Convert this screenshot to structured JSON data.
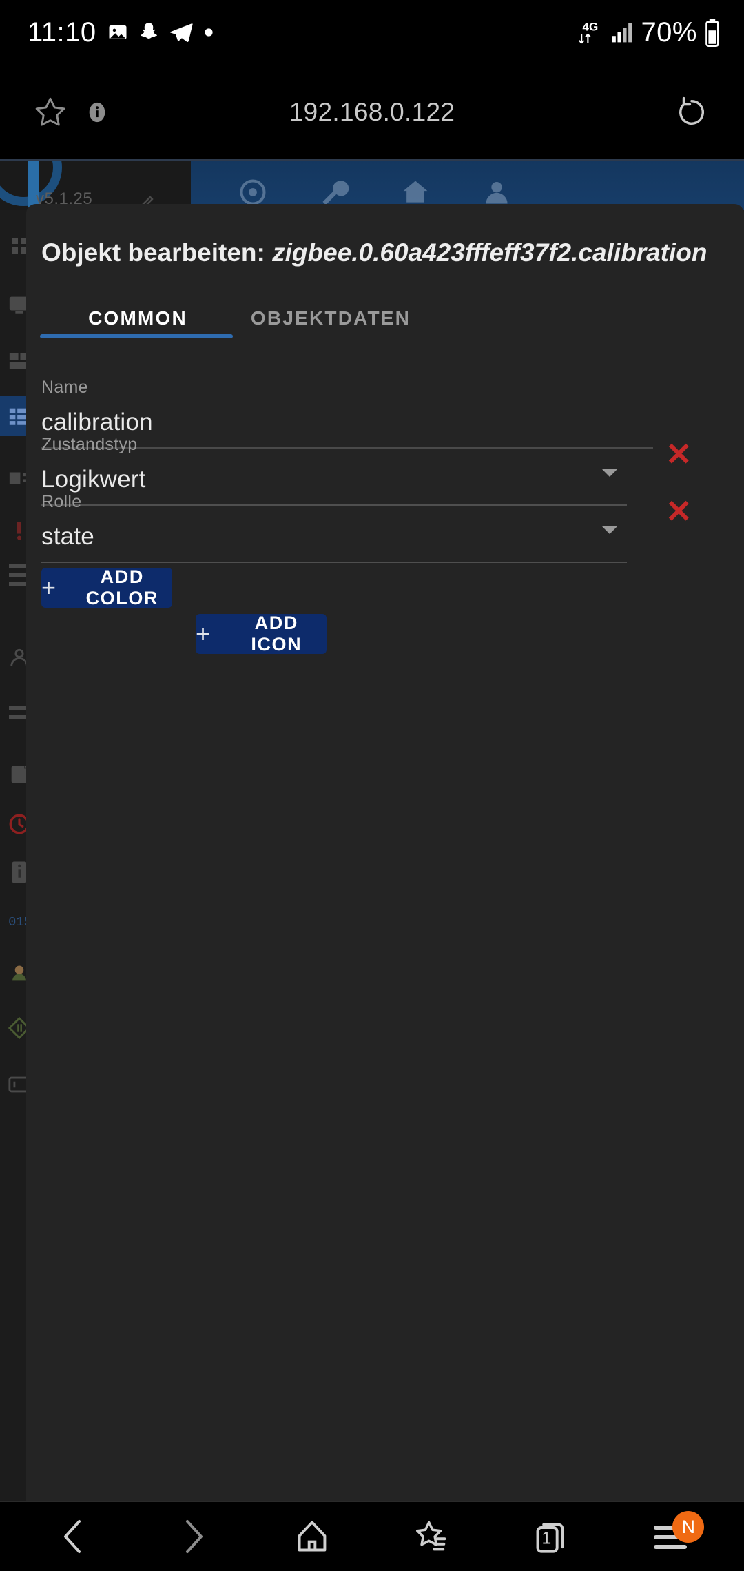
{
  "status_bar": {
    "clock": "11:10",
    "network_type": "4G",
    "battery_percent": "70%",
    "icons": [
      "image-icon",
      "snapchat-icon",
      "telegram-icon",
      "dot-icon",
      "data-transfer-icon",
      "signal-bars-icon",
      "battery-icon"
    ]
  },
  "browser": {
    "url": "192.168.0.122",
    "star_icon": "star-icon",
    "info_icon": "info-icon",
    "reload_icon": "reload-icon"
  },
  "background_app": {
    "version": "v5.1.25",
    "toolbar_icons": [
      "power-icon",
      "wrench-icon",
      "home-icon",
      "user-icon"
    ],
    "pencil_icon": "pencil-icon"
  },
  "dialog": {
    "title_prefix": "Objekt bearbeiten: ",
    "object_id": "zigbee.0.60a423fffeff37f2.calibration",
    "tabs": [
      {
        "label": "COMMON",
        "active": true
      },
      {
        "label": "OBJEKTDATEN",
        "active": false
      }
    ],
    "fields": [
      {
        "label": "Name",
        "value": "calibration",
        "type": "text",
        "deletable": false
      },
      {
        "label": "Zustandstyp",
        "value": "Logikwert",
        "type": "select",
        "deletable": true
      },
      {
        "label": "Rolle",
        "value": "state",
        "type": "select",
        "deletable": true
      }
    ],
    "buttons": [
      {
        "label": "ADD COLOR",
        "icon": "plus-icon"
      },
      {
        "label": "ADD ICON",
        "icon": "plus-icon"
      }
    ],
    "delete_glyph": "✕",
    "accent_color": "#2f6cb0",
    "button_color": "#0d2b6b",
    "delete_color": "#c62828"
  },
  "bottom_nav": {
    "items": [
      {
        "name": "back",
        "icon": "chevron-left-icon"
      },
      {
        "name": "forward",
        "icon": "chevron-right-icon"
      },
      {
        "name": "home",
        "icon": "home-icon"
      },
      {
        "name": "bookmarks",
        "icon": "star-list-icon"
      },
      {
        "name": "tabs",
        "icon": "tabs-icon",
        "count": "1"
      },
      {
        "name": "menu",
        "icon": "hamburger-icon",
        "badge": "N"
      }
    ],
    "badge_color": "#f06a13"
  }
}
